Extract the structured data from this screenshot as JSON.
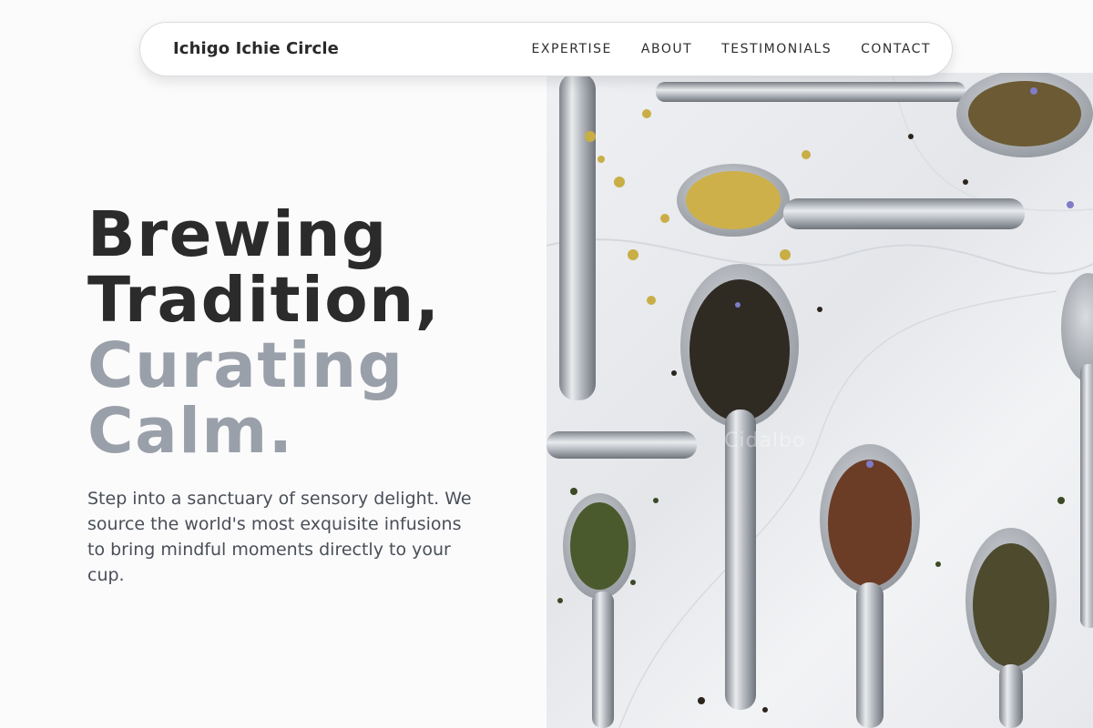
{
  "brand": {
    "name": "Ichigo Ichie Circle"
  },
  "nav": {
    "links": [
      "EXPERTISE",
      "ABOUT",
      "TESTIMONIALS",
      "CONTACT"
    ]
  },
  "hero": {
    "headline_line1": "Brewing",
    "headline_line2": "Tradition,",
    "headline_line3": "Curating",
    "headline_line4": "Calm.",
    "lead": "Step into a sanctuary of sensory delight. We source the world's most exquisite infusions to bring mindful moments directly to your cup.",
    "image_watermark": "Cidalbo"
  },
  "colors": {
    "background": "#fbfbfc",
    "text_dark": "#2b2b2b",
    "text_muted": "#9aa0a9",
    "body_text": "#4a4f57"
  }
}
